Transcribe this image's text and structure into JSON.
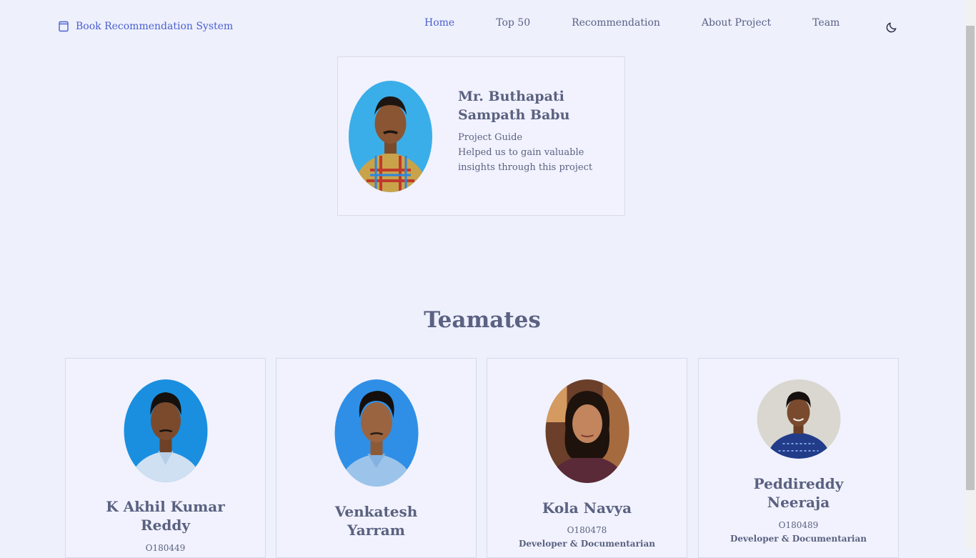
{
  "brand": {
    "icon": "book-icon",
    "label": "Book Recommendation System"
  },
  "nav": {
    "items": [
      {
        "label": "Home",
        "active": true
      },
      {
        "label": "Top 50"
      },
      {
        "label": "Recommendation"
      },
      {
        "label": "About Project"
      },
      {
        "label": "Team"
      }
    ],
    "theme_icon": "moon-icon"
  },
  "guide": {
    "name_line1": "Mr. Buthapati",
    "name_line2": "Sampath Babu",
    "role": "Project Guide",
    "desc_line1": "Helped us to gain valuable",
    "desc_line2": "insights through this project"
  },
  "team": {
    "title": "Teamates",
    "members": [
      {
        "name_line1": "K Akhil Kumar",
        "name_line2": "Reddy",
        "id": "O180449",
        "role": ""
      },
      {
        "name_line1": "Venkatesh",
        "name_line2": "Yarram",
        "id": "",
        "role": ""
      },
      {
        "name_line1": "Kola Navya",
        "name_line2": "",
        "id": "O180478",
        "role": "Developer & Documentarian"
      },
      {
        "name_line1": "Peddireddy",
        "name_line2": "Neeraja",
        "id": "O180489",
        "role": "Developer & Documentarian"
      }
    ]
  },
  "colors": {
    "background": "#eef0fc",
    "accent": "#4a5fd0",
    "text": "#5b6282"
  }
}
